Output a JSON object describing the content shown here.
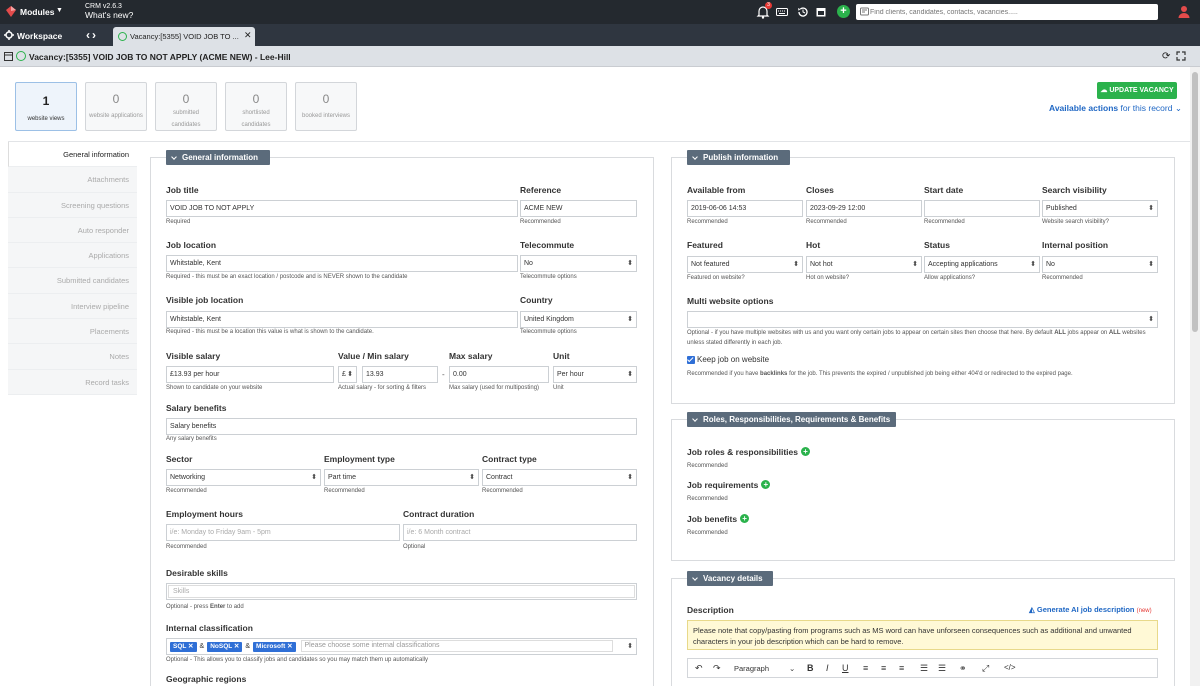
{
  "topbar": {
    "modules_label": "Modules",
    "crm_version": "CRM v2.6.3",
    "whats_new": "What's new?",
    "notification_count": "3",
    "search_placeholder": "Find clients, candidates, contacts, vacancies....."
  },
  "workspace": {
    "label": "Workspace",
    "tab_label": "Vacancy:[5355] VOID JOB TO ..."
  },
  "title": "Vacancy:[5355] VOID JOB TO NOT APPLY (ACME NEW) - Lee-Hill",
  "stats": [
    {
      "value": "1",
      "label": "website views"
    },
    {
      "value": "0",
      "label": "website applications"
    },
    {
      "value": "0",
      "label": "submitted candidates"
    },
    {
      "value": "0",
      "label": "shortlisted candidates"
    },
    {
      "value": "0",
      "label": "booked interviews"
    }
  ],
  "actions": {
    "update_label": "UPDATE VACANCY",
    "available_bold": "Available actions",
    "available_rest": " for this record"
  },
  "sidenav": [
    "General information",
    "Attachments",
    "Screening questions",
    "Auto responder",
    "Applications",
    "Submitted candidates",
    "Interview pipeline",
    "Placements",
    "Notes",
    "Record tasks"
  ],
  "general": {
    "header": "General information",
    "job_title_label": "Job title",
    "job_title_value": "VOID JOB TO NOT APPLY",
    "job_title_help": "Required",
    "reference_label": "Reference",
    "reference_value": "ACME NEW",
    "reference_help": "Recommended",
    "job_location_label": "Job location",
    "job_location_value": "Whitstable, Kent",
    "job_location_help": "Required - this must be an exact location / postcode and is NEVER shown to the candidate",
    "telecommute_label": "Telecommute",
    "telecommute_value": "No",
    "telecommute_help": "Telecommute options",
    "visible_location_label": "Visible job location",
    "visible_location_value": "Whitstable, Kent",
    "visible_location_help": "Required - this must be a location this value is what is shown to the candidate.",
    "country_label": "Country",
    "country_value": "United Kingdom",
    "country_help": "Telecommute options",
    "visible_salary_label": "Visible salary",
    "visible_salary_value": "£13.93 per hour",
    "visible_salary_help": "Shown to candidate on your website",
    "min_salary_label": "Value / Min salary",
    "currency_value": "£",
    "min_salary_value": "13.93",
    "min_salary_help": "Actual salary - for sorting & filters",
    "dash": "-",
    "max_salary_label": "Max salary",
    "max_salary_value": "0.00",
    "max_salary_help": "Max salary (used for multiposting)",
    "unit_label": "Unit",
    "unit_value": "Per hour",
    "unit_help": "Unit",
    "salary_benefits_label": "Salary benefits",
    "salary_benefits_value": "Salary benefits",
    "salary_benefits_help": "Any salary benefits",
    "sector_label": "Sector",
    "sector_value": "Networking",
    "sector_help": "Recommended",
    "employment_type_label": "Employment type",
    "employment_type_value": "Part time",
    "employment_type_help": "Recommended",
    "contract_type_label": "Contract type",
    "contract_type_value": "Contract",
    "contract_type_help": "Recommended",
    "employment_hours_label": "Employment hours",
    "employment_hours_placeholder": "i/e: Monday to Friday 9am - 5pm",
    "employment_hours_help": "Recommended",
    "contract_duration_label": "Contract duration",
    "contract_duration_placeholder": "i/e: 6 Month contract",
    "contract_duration_help": "Optional",
    "desirable_skills_label": "Desirable skills",
    "skills_placeholder": "Skills",
    "skills_help_pre": "Optional - press ",
    "skills_help_key": "Enter",
    "skills_help_post": " to add",
    "internal_class_label": "Internal classification",
    "class_tags": [
      "SQL",
      "NoSQL",
      "Microsoft"
    ],
    "class_amp": "&",
    "class_placeholder": "Please choose some internal classifications",
    "class_help": "Optional - This allows you to classify jobs and candidates so you may match them up automatically",
    "geo_label": "Geographic regions"
  },
  "publish": {
    "header": "Publish information",
    "available_from_label": "Available from",
    "available_from_value": "2019-06-06 14:53",
    "available_from_help": "Recommended",
    "closes_label": "Closes",
    "closes_value": "2023-09-29 12:00",
    "closes_help": "Recommended",
    "start_date_label": "Start date",
    "start_date_help": "Recommended",
    "search_vis_label": "Search visibility",
    "search_vis_value": "Published",
    "search_vis_help": "Website search visibility?",
    "featured_label": "Featured",
    "featured_value": "Not featured",
    "featured_help": "Featured on website?",
    "hot_label": "Hot",
    "hot_value": "Not hot",
    "hot_help": "Hot on website?",
    "status_label": "Status",
    "status_value": "Accepting applications",
    "status_help": "Allow applications?",
    "internal_pos_label": "Internal position",
    "internal_pos_value": "No",
    "internal_pos_help": "Recommended",
    "multi_label": "Multi website options",
    "multi_help_1": "Optional - if you have multiple websites with us and you want only certain jobs to appear on certain sites then choose that here. By default ",
    "multi_help_all1": "ALL",
    "multi_help_2": " jobs appear on ",
    "multi_help_all2": "ALL",
    "multi_help_3": "websites unless stated differently in each job.",
    "keep_label": "Keep job on website",
    "keep_help_1": "Recommended if you have ",
    "keep_help_b": "backlinks",
    "keep_help_2": " for the job. This prevents the expired / unpublished job being either 404'd or redirected to the expired page."
  },
  "roles": {
    "header": "Roles, Responsibilities, Requirements & Benefits",
    "responsibilities_label": "Job roles & responsibilities",
    "requirements_label": "Job requirements",
    "benefits_label": "Job benefits",
    "help": "Recommended"
  },
  "details": {
    "header": "Vacancy details",
    "description_label": "Description",
    "ai_label": "Generate AI job description",
    "ai_new": "(new)",
    "notice": "Please note that copy/pasting from programs such as MS word can have unforseen consequences such as additional and unwanted characters in your job description which can be hard to remove.",
    "paragraph": "Paragraph"
  }
}
